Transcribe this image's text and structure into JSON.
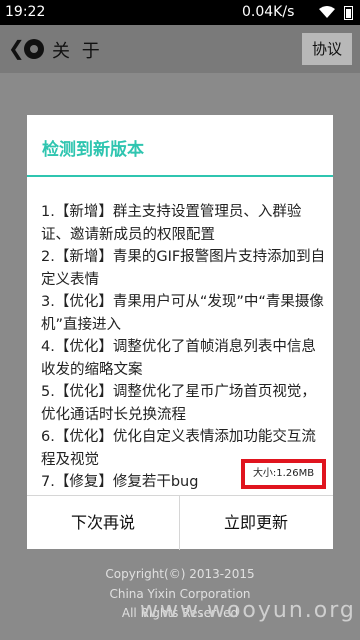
{
  "status_bar": {
    "time": "19:22",
    "speed": "0.04K/s",
    "wifi_icon": "wifi-icon",
    "battery_icon": "battery-icon"
  },
  "app_bar": {
    "title": "关 于",
    "agreement_label": "协议"
  },
  "background": {
    "copyright": "Copyright(©) 2013-2015",
    "company": "China Yixin Corporation",
    "rights": "All Rights Reserved"
  },
  "dialog": {
    "title": "检测到新版本",
    "notes": [
      "1.【新增】群主支持设置管理员、入群验证、邀请新成员的权限配置",
      "2.【新增】青果的GIF报警图片支持添加到自定义表情",
      "3.【优化】青果用户可从“发现”中“青果摄像机”直接进入",
      "4.【优化】调整优化了首帧消息列表中信息收发的缩略文案",
      "5.【优化】调整优化了星币广场首页视觉，优化通话时长兑换流程",
      "6.【优化】优化自定义表情添加功能交互流程及视觉",
      "7.【修复】修复若干bug"
    ],
    "size_label": "大小:1.26MB",
    "later_label": "下次再说",
    "update_label": "立即更新"
  },
  "watermark": "www.wooyun.org",
  "colors": {
    "accent": "#2fc5b0",
    "highlight_box": "#e0141e"
  }
}
